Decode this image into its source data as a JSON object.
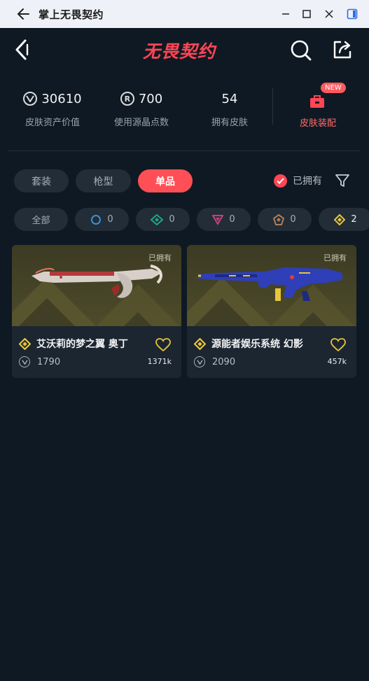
{
  "window": {
    "title": "掌上无畏契约"
  },
  "header": {
    "logo": "无畏契约"
  },
  "stats": {
    "asset_value": {
      "value": "30610",
      "label": "皮肤资产价值",
      "icon": "valorant-points-icon"
    },
    "radianite": {
      "value": "700",
      "label": "使用源晶点数",
      "icon": "radianite-icon"
    },
    "owned_skins": {
      "value": "54",
      "label": "拥有皮肤"
    },
    "equip": {
      "badge": "NEW",
      "label": "皮肤装配",
      "icon": "locker-icon"
    }
  },
  "tabs": [
    {
      "label": "套装",
      "active": false
    },
    {
      "label": "枪型",
      "active": false
    },
    {
      "label": "单品",
      "active": true
    }
  ],
  "owned_filter": {
    "label": "已拥有",
    "checked": true
  },
  "rarity_filters": [
    {
      "label": "全部",
      "count": ""
    },
    {
      "icon": "select-tier-icon",
      "count": "0",
      "color": "#3b8fd6"
    },
    {
      "icon": "deluxe-tier-icon",
      "count": "0",
      "color": "#1fa38a"
    },
    {
      "icon": "premium-tier-icon",
      "count": "0",
      "color": "#c8417a"
    },
    {
      "icon": "ultra-tier-icon",
      "count": "0",
      "color": "#b07c5a"
    },
    {
      "icon": "exclusive-tier-icon",
      "count": "2",
      "color": "#e8c53a"
    }
  ],
  "skins": [
    {
      "owned_label": "已拥有",
      "name": "艾沃莉的梦之翼 奥丁",
      "price": "1790",
      "likes": "1371k"
    },
    {
      "owned_label": "已拥有",
      "name": "源能者娱乐系统 幻影",
      "price": "2090",
      "likes": "457k"
    }
  ],
  "colors": {
    "accent": "#ff4655",
    "background": "#0f1923",
    "card": "#1b2631",
    "gold": "#e8c53a"
  }
}
